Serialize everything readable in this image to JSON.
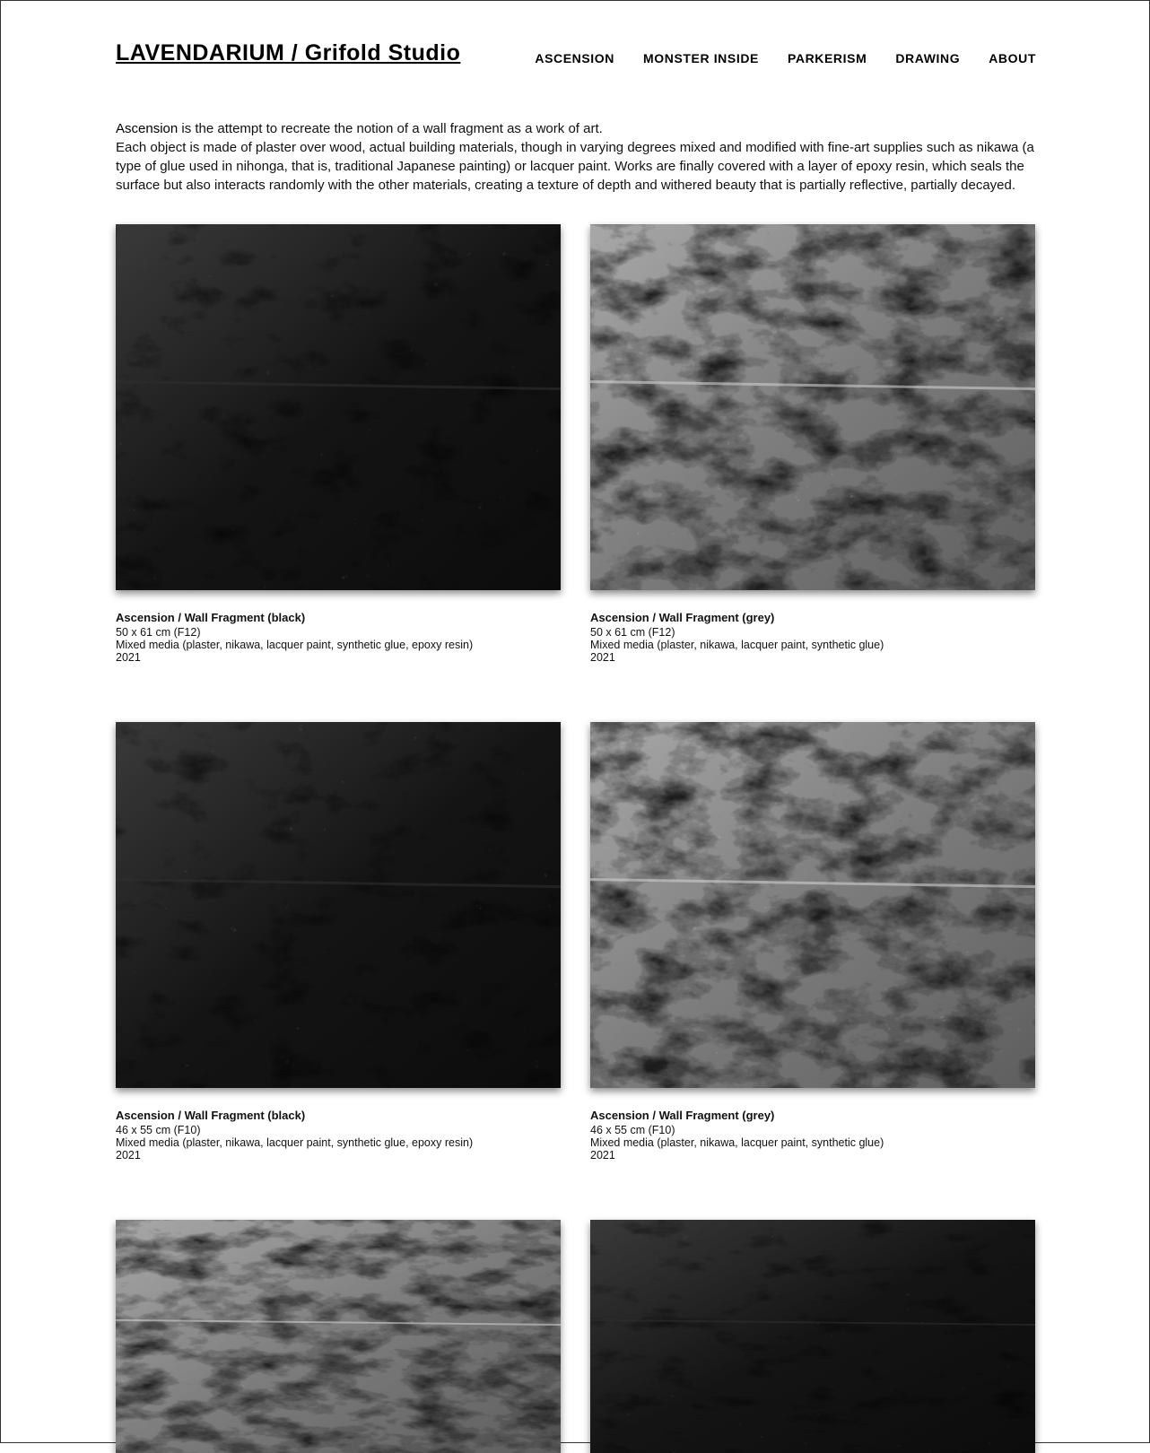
{
  "site": {
    "title": "LAVENDARIUM / Grifold Studio"
  },
  "nav": [
    "ASCENSION",
    "MONSTER INSIDE",
    "PARKERISM",
    "DRAWING",
    "ABOUT"
  ],
  "intro": {
    "lead_bold": "Ascension",
    "lead_rest": " is the attempt to recreate the notion of a wall fragment as a work of art.",
    "body": "Each object is made of plaster over wood, actual building materials, though in varying degrees mixed and modified with fine-art supplies such as nikawa (a type of glue used in nihonga, that is, traditional Japanese painting) or lacquer paint. Works are finally covered with a layer of epoxy resin, which seals the surface but also interacts randomly with the other materials, creating a texture of depth and withered beauty that is partially reflective, partially decayed."
  },
  "works": [
    {
      "title": "Ascension / Wall Fragment (black)",
      "size": "50 x 61 cm (F12)",
      "medium": "Mixed media (plaster, nikawa, lacquer paint, synthetic glue, epoxy resin)",
      "year": "2021",
      "tone": "black"
    },
    {
      "title": "Ascension / Wall Fragment (grey)",
      "size": "50 x 61 cm (F12)",
      "medium": "Mixed media (plaster, nikawa, lacquer paint, synthetic glue)",
      "year": "2021",
      "tone": "grey"
    },
    {
      "title": "Ascension / Wall Fragment (black)",
      "size": "46 x 55 cm (F10)",
      "medium": "Mixed media (plaster, nikawa, lacquer paint, synthetic glue, epoxy resin)",
      "year": "2021",
      "tone": "black"
    },
    {
      "title": "Ascension / Wall Fragment (grey)",
      "size": "46 x 55 cm (F10)",
      "medium": "Mixed media (plaster, nikawa, lacquer paint, synthetic glue)",
      "year": "2021",
      "tone": "grey"
    },
    {
      "tone": "grey"
    },
    {
      "tone": "black"
    }
  ]
}
